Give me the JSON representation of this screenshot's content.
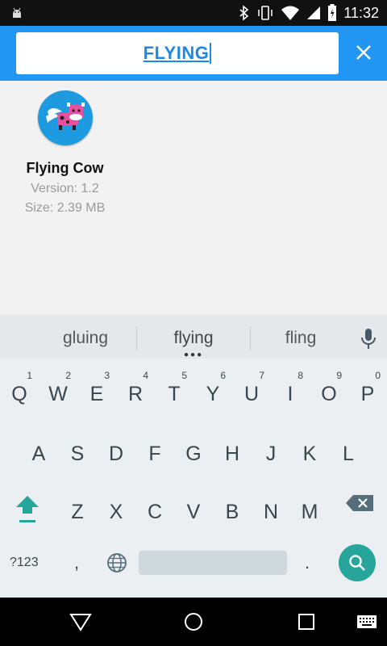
{
  "status_bar": {
    "time": "11:32"
  },
  "search": {
    "query": "FLYING"
  },
  "results": [
    {
      "name": "Flying Cow",
      "version": "Version: 1.2",
      "size": "Size: 2.39 MB"
    }
  ],
  "keyboard": {
    "suggestions": [
      "gluing",
      "flying",
      "fling"
    ],
    "row1": [
      {
        "key": "Q",
        "num": "1"
      },
      {
        "key": "W",
        "num": "2"
      },
      {
        "key": "E",
        "num": "3"
      },
      {
        "key": "R",
        "num": "4"
      },
      {
        "key": "T",
        "num": "5"
      },
      {
        "key": "Y",
        "num": "6"
      },
      {
        "key": "U",
        "num": "7"
      },
      {
        "key": "I",
        "num": "8"
      },
      {
        "key": "O",
        "num": "9"
      },
      {
        "key": "P",
        "num": "0"
      }
    ],
    "row2": [
      "A",
      "S",
      "D",
      "F",
      "G",
      "H",
      "J",
      "K",
      "L"
    ],
    "row3": [
      "Z",
      "X",
      "C",
      "V",
      "B",
      "N",
      "M"
    ],
    "symbols_label": "?123",
    "comma": ",",
    "period": ".",
    "accent_color": "#26a69a"
  },
  "theme": {
    "appbar_color": "#2196f3",
    "icon_bg": "#1e9be0"
  }
}
